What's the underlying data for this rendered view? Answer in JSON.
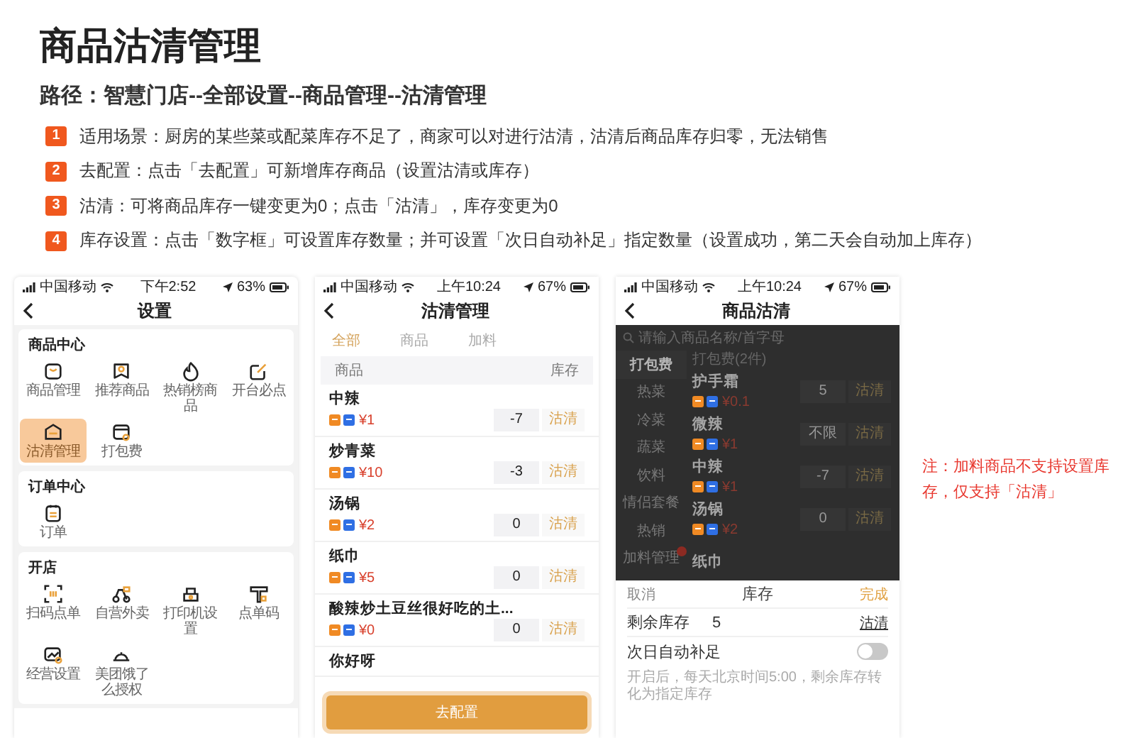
{
  "title": "商品沽清管理",
  "path": "路径：智慧门店--全部设置--商品管理--沽清管理",
  "steps": [
    {
      "number": "1",
      "text": "适用场景：厨房的某些菜或配菜库存不足了，商家可以对进行沽清，沽清后商品库存归零，无法销售"
    },
    {
      "number": "2",
      "text": "去配置：点击「去配置」可新增库存商品（设置沽清或库存）"
    },
    {
      "number": "3",
      "text": "沽清：可将商品库存一键变更为0；点击「沽清」，库存变更为0"
    },
    {
      "number": "4",
      "text": "库存设置：点击「数字框」可设置库存数量；并可设置「次日自动补足」指定数量（设置成功，第二天会自动加上库存）"
    }
  ],
  "settings_screen": {
    "status": {
      "carrier": "中国移动",
      "time": "下午2:52",
      "battery": "63%"
    },
    "title": "设置",
    "sections": [
      {
        "title": "商品中心",
        "items": [
          {
            "label": "商品管理",
            "selected": false
          },
          {
            "label": "推荐商品",
            "selected": false
          },
          {
            "label": "热销榜商品",
            "selected": false
          },
          {
            "label": "开台必点",
            "selected": false
          },
          {
            "label": "沽清管理",
            "selected": true
          },
          {
            "label": "打包费",
            "selected": false
          }
        ]
      },
      {
        "title": "订单中心",
        "items": [
          {
            "label": "订单",
            "selected": false
          }
        ]
      },
      {
        "title": "开店",
        "items": [
          {
            "label": "扫码点单",
            "selected": false
          },
          {
            "label": "自营外卖",
            "selected": false
          },
          {
            "label": "打印机设置",
            "selected": false
          },
          {
            "label": "点单码",
            "selected": false
          },
          {
            "label": "经营设置",
            "selected": false
          },
          {
            "label": "美团饿了么授权",
            "selected": false
          }
        ]
      }
    ]
  },
  "stock_screen": {
    "status": {
      "carrier": "中国移动",
      "time": "上午10:24",
      "battery": "67%"
    },
    "title": "沽清管理",
    "tabs": [
      {
        "label": "全部",
        "selected": true
      },
      {
        "label": "商品",
        "selected": false
      },
      {
        "label": "加料",
        "selected": false
      }
    ],
    "columns": [
      "商品",
      "库存"
    ],
    "rows": [
      {
        "name": "中辣",
        "price": "¥1",
        "stock": "-7",
        "action": "沽清"
      },
      {
        "name": "炒青菜",
        "price": "¥10",
        "stock": "-3",
        "action": "沽清"
      },
      {
        "name": "汤锅",
        "price": "¥2",
        "stock": "0",
        "action": "沽清"
      },
      {
        "name": "纸巾",
        "price": "¥5",
        "stock": "0",
        "action": "沽清"
      },
      {
        "name": "酸辣炒土豆丝很好吃的土...",
        "price": "¥0",
        "stock": "0",
        "action": "沽清"
      },
      {
        "name": "你好呀"
      }
    ],
    "button": "去配置"
  },
  "edit_screen": {
    "status": {
      "carrier": "中国移动",
      "time": "上午10:24",
      "battery": "67%"
    },
    "title": "商品沽清",
    "search": {
      "placeholder": "请输入商品名称/首字母"
    },
    "categories": [
      {
        "label": "打包费",
        "selected": true,
        "badge": false
      },
      {
        "label": "热菜",
        "selected": false,
        "badge": false
      },
      {
        "label": "冷菜",
        "selected": false,
        "badge": false
      },
      {
        "label": "蔬菜",
        "selected": false,
        "badge": false
      },
      {
        "label": "饮料",
        "selected": false,
        "badge": false
      },
      {
        "label": "情侣套餐",
        "selected": false,
        "badge": false
      },
      {
        "label": "热销",
        "selected": false,
        "badge": false
      },
      {
        "label": "加料管理",
        "selected": false,
        "badge": true
      }
    ],
    "group_title": "打包费(2件)",
    "items": [
      {
        "name": "护手霜",
        "price": "¥0.1",
        "stock": "5",
        "action": "沽清"
      },
      {
        "name": "微辣",
        "price": "¥1",
        "stock": "不限",
        "action": "沽清"
      },
      {
        "name": "中辣",
        "price": "¥1",
        "stock": "-7",
        "action": "沽清"
      },
      {
        "name": "汤锅",
        "price": "¥2",
        "stock": "0",
        "action": "沽清"
      },
      {
        "name": "纸巾"
      }
    ],
    "sheet": {
      "cancel": "取消",
      "title": "库存",
      "confirm": "完成",
      "remaining_label": "剩余库存",
      "remaining_value": "5",
      "remaining_action": "沽清",
      "auto_label": "次日自动补足",
      "auto_on": false,
      "hint": "开启后，每天北京时间5:00，剩余库存转化为指定库存"
    }
  },
  "note": "注：加料商品不支持设置库存，仅支持「沽清」"
}
